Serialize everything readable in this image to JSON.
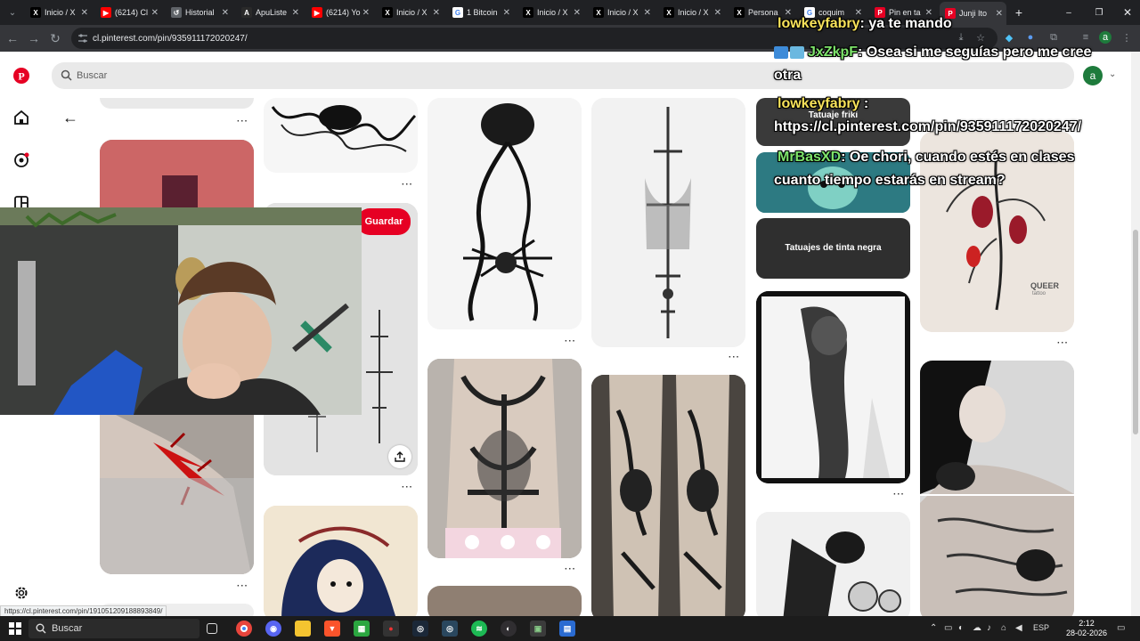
{
  "browser": {
    "tabs": [
      {
        "label": "Inicio / X",
        "icon": "x-logo-icon"
      },
      {
        "label": "(6214) Cl",
        "icon": "youtube-icon"
      },
      {
        "label": "Historial",
        "icon": "history-icon"
      },
      {
        "label": "ApuListe",
        "icon": "apulist-icon"
      },
      {
        "label": "(6214) Yo",
        "icon": "youtube-icon"
      },
      {
        "label": "Inicio / X",
        "icon": "x-logo-icon"
      },
      {
        "label": "1 Bitcoin",
        "icon": "google-icon"
      },
      {
        "label": "Inicio / X",
        "icon": "x-logo-icon"
      },
      {
        "label": "Inicio / X",
        "icon": "x-logo-icon"
      },
      {
        "label": "Inicio / X",
        "icon": "x-logo-icon"
      },
      {
        "label": "Persona",
        "icon": "x-logo-icon"
      },
      {
        "label": "coquim",
        "icon": "google-icon"
      },
      {
        "label": "Pin en ta",
        "icon": "pinterest-icon"
      },
      {
        "label": "Junji Ito",
        "icon": "pinterest-icon"
      }
    ],
    "url": "cl.pinterest.com/pin/935911172020247/"
  },
  "pinterest": {
    "search_placeholder": "Buscar",
    "avatar_letter": "a",
    "save_label": "Guardar",
    "more_label": "···",
    "boards": {
      "friki": "Tatuaje friki",
      "tinta": "Tatuajes de tinta negra"
    },
    "queer_text": "QUEER",
    "queer_sub": "tattoo"
  },
  "chat": [
    {
      "user": "lowkeyfabry",
      "message": ": ya te mando",
      "color": "#f7e25a"
    },
    {
      "user": "JxZkpF",
      "message": ": Osea si me seguías pero me cree",
      "color": "#7de36b"
    },
    {
      "user": "",
      "message": "otra",
      "color": ""
    },
    {
      "user": "lowkeyfabry",
      "message": " :",
      "color": "#f7e25a"
    },
    {
      "user": "",
      "message": "https://cl.pinterest.com/pin/935911172020247/",
      "color": ""
    },
    {
      "user": "MrBasXD",
      "message": ": Oe chori, cuando estés en clases",
      "color": "#7de36b"
    },
    {
      "user": "",
      "message": "cuanto tiempo estarás en stream?",
      "color": ""
    }
  ],
  "status_url": "https://cl.pinterest.com/pin/191051209188893849/",
  "taskbar": {
    "search_placeholder": "Buscar",
    "language": "ESP",
    "time": "2:12",
    "date": "28-02-2026"
  }
}
